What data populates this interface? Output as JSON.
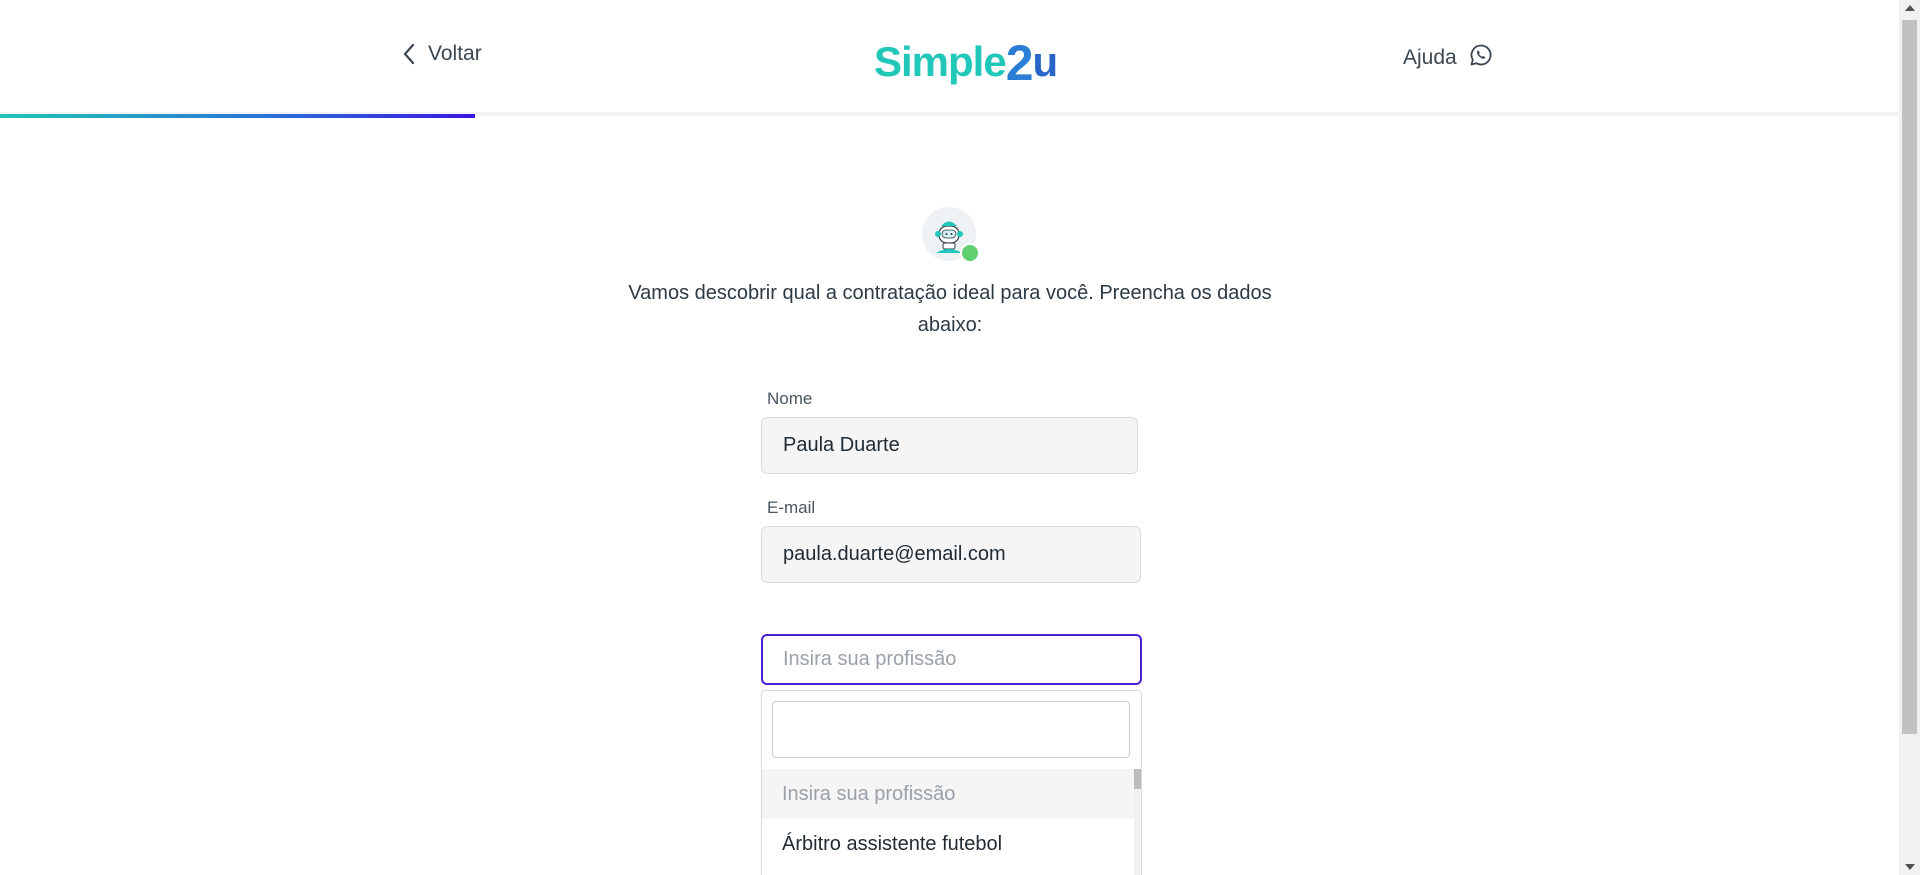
{
  "header": {
    "back_label": "Voltar",
    "logo": {
      "part1": "Simple",
      "part2": "2",
      "part3": "u"
    },
    "help_label": "Ajuda",
    "progress": 0.25
  },
  "intro_text": "Vamos descobrir qual a contratação ideal para você. Preencha os dados abaixo:",
  "form": {
    "name": {
      "label": "Nome",
      "value": "Paula Duarte"
    },
    "email": {
      "label": "E-mail",
      "value": "paula.duarte@email.com"
    },
    "profession": {
      "placeholder": "Insira sua profissão",
      "dropdown_search_value": "",
      "options": [
        "Insira sua profissão",
        "Árbitro assistente futebol"
      ]
    }
  },
  "colors": {
    "accent_teal": "#21c7b9",
    "accent_blue": "#2766c8",
    "focus_purple": "#4b1fd8",
    "status_online": "#5fcf6f"
  },
  "icons": {
    "back": "chevron-left-icon",
    "help": "whatsapp-icon",
    "avatar": "robot-avatar-icon"
  }
}
